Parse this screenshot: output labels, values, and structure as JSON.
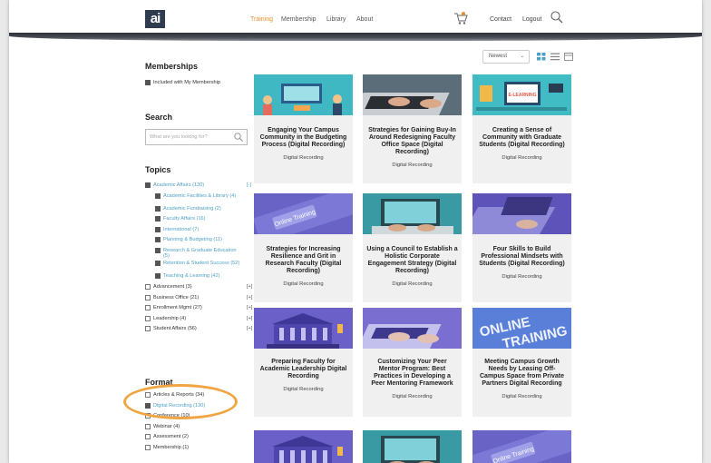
{
  "header": {
    "logo": "ai",
    "nav": [
      "Training",
      "Membership",
      "Library",
      "About"
    ],
    "active_nav": "Training",
    "contact": "Contact",
    "logout": "Logout",
    "accent": "#e8902b"
  },
  "sidebar": {
    "memberships_heading": "Memberships",
    "memberships_option": "Included with My Membership",
    "search_heading": "Search",
    "search_placeholder": "What are you looking for?",
    "topics_heading": "Topics",
    "topics": [
      {
        "label": "Academic Affairs (130)",
        "checked": true,
        "expand": "[-]",
        "indent": 0,
        "lines": 1
      },
      {
        "label": "Academic Facilities & Library (4)",
        "checked": true,
        "indent": 1,
        "lines": 2
      },
      {
        "label": "Academic Fundraising (2)",
        "checked": true,
        "indent": 1,
        "lines": 1
      },
      {
        "label": "Faculty Affairs (16)",
        "checked": true,
        "indent": 1,
        "lines": 1
      },
      {
        "label": "International (7)",
        "checked": true,
        "indent": 1,
        "lines": 1
      },
      {
        "label": "Planning & Budgeting (11)",
        "checked": true,
        "indent": 1,
        "lines": 1
      },
      {
        "label": "Research & Graduate Education (5)",
        "checked": true,
        "indent": 1,
        "lines": 2
      },
      {
        "label": "Retention & Student Success (52)",
        "checked": true,
        "indent": 1,
        "lines": 2
      },
      {
        "label": "Teaching & Learning (42)",
        "checked": true,
        "indent": 1,
        "lines": 1
      },
      {
        "label": "Advancement (3)",
        "checked": false,
        "expand": "[+]",
        "indent": 0,
        "lines": 1
      },
      {
        "label": "Business Office (21)",
        "checked": false,
        "expand": "[+]",
        "indent": 0,
        "lines": 1
      },
      {
        "label": "Enrollment Mgmt (27)",
        "checked": false,
        "expand": "[+]",
        "indent": 0,
        "lines": 1
      },
      {
        "label": "Leadership (4)",
        "checked": false,
        "expand": "[+]",
        "indent": 0,
        "lines": 1
      },
      {
        "label": "Student Affairs (56)",
        "checked": false,
        "expand": "[+]",
        "indent": 0,
        "lines": 1
      }
    ],
    "format_heading": "Format",
    "formats": [
      {
        "label": "Articles & Reports (34)",
        "checked": false,
        "color": "#333"
      },
      {
        "label": "Digital Recording (130)",
        "checked": true,
        "color": "#4fa2c8"
      },
      {
        "label": "Conference (10)",
        "checked": false,
        "color": "#333"
      },
      {
        "label": "Webinar (4)",
        "checked": false,
        "color": "#333"
      },
      {
        "label": "Assessment (2)",
        "checked": false,
        "color": "#333"
      },
      {
        "label": "Membership (1)",
        "checked": false,
        "color": "#333"
      }
    ]
  },
  "toolbar": {
    "sort_value": "Newest"
  },
  "products": [
    {
      "title": "Engaging Your Campus Community in the Budgeting Process (Digital Recording)",
      "type": "Digital Recording",
      "theme": "teal-people"
    },
    {
      "title": "Strategies for Gaining Buy-In Around Redesigning Faculty Office Space (Digital Recording)",
      "type": "Digital Recording",
      "theme": "laptop-hands"
    },
    {
      "title": "Creating a Sense of Community with Graduate Students (Digital Recording)",
      "type": "Digital Recording",
      "theme": "teal-elearning"
    },
    {
      "title": "Strategies for Increasing Resilience and Grit in Research Faculty (Digital Recording)",
      "type": "Digital Recording",
      "theme": "purple-keyboard-online"
    },
    {
      "title": "Using a Council to Establish a Holistic Corporate Engagement Strategy (Digital Recording)",
      "type": "Digital Recording",
      "theme": "teal-laptop"
    },
    {
      "title": "Four Skills to Build Professional Mindsets with Students (Digital Recording)",
      "type": "Digital Recording",
      "theme": "purple-laptop"
    },
    {
      "title": "Preparing Faculty for Academic Leadership Digital Recording",
      "type": "Digital Recording",
      "theme": "purple-building"
    },
    {
      "title": "Customizing Your Peer Mentor Program: Best Practices in Developing a Peer Mentoring Framework",
      "type": "Digital Recording",
      "theme": "purple-laptop-hands"
    },
    {
      "title": "Meeting Campus Growth Needs by Leasing Off-Campus Space from Private Partners Digital Recording",
      "type": "Digital Recording",
      "theme": "blue-online-training"
    }
  ],
  "thumb_texts": {
    "online_training": "Online Training",
    "online_training_big": "ONLINE TRAINING",
    "elearning": "E-LEARNING"
  },
  "highlight_color": "#f0a542"
}
